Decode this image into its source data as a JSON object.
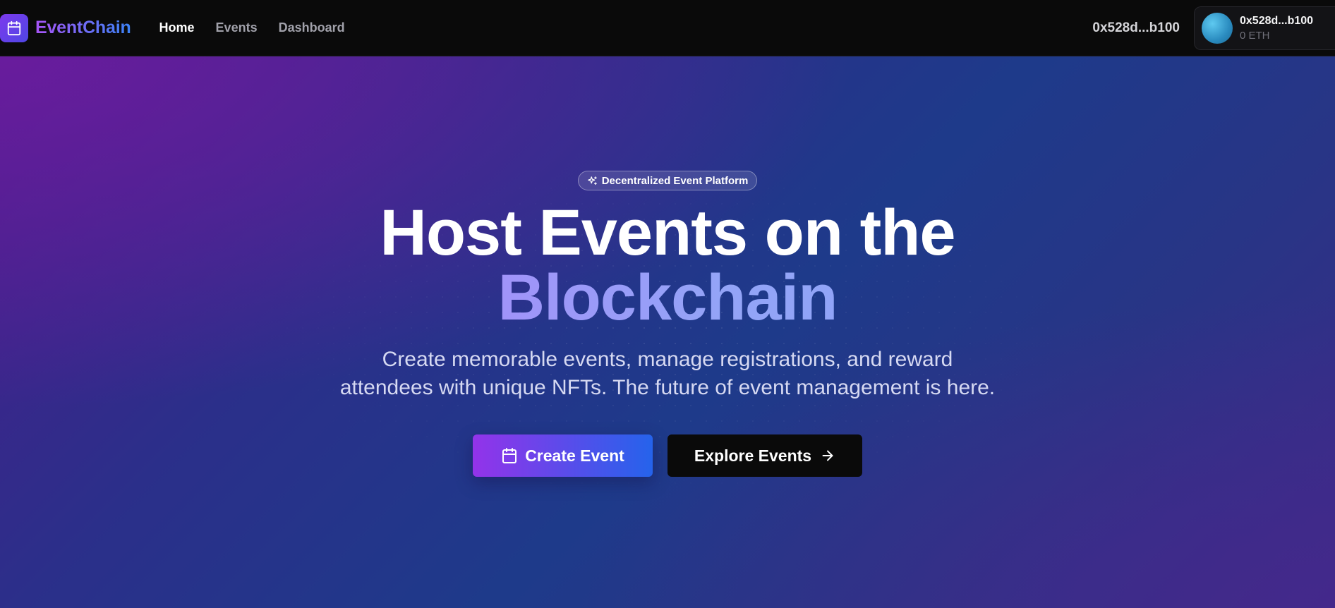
{
  "navbar": {
    "brand": "EventChain",
    "links": [
      {
        "label": "Home",
        "active": true
      },
      {
        "label": "Events",
        "active": false
      },
      {
        "label": "Dashboard",
        "active": false
      }
    ],
    "address": "0x528d...b100",
    "wallet": {
      "address": "0x528d...b100",
      "balance": "0 ETH"
    }
  },
  "hero": {
    "badge": "Decentralized Event Platform",
    "headline_line1": "Host Events on the",
    "headline_line2": "Blockchain",
    "subtitle": "Create memorable events, manage registrations, and reward attendees with unique NFTs. The future of event management is here.",
    "primary_button": "Create Event",
    "secondary_button": "Explore Events"
  },
  "icons": {
    "brand_logo": "calendar-icon",
    "badge": "sparkles-icon",
    "primary_button": "calendar-icon",
    "secondary_button": "arrow-right-icon"
  },
  "colors": {
    "accent_purple": "#9333ea",
    "accent_blue": "#2563eb",
    "navbar_bg": "#0a0a0a"
  }
}
